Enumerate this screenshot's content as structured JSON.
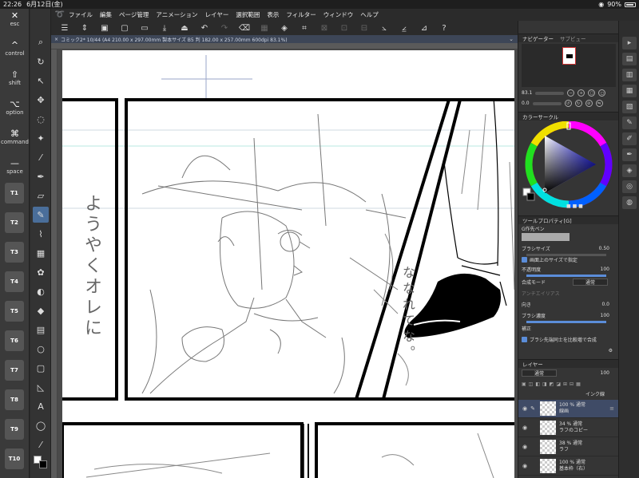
{
  "status": {
    "time": "22:26",
    "date": "6月12日(金)",
    "battery": "90%"
  },
  "modifiers": [
    {
      "glyph": "✕",
      "label": "esc"
    },
    {
      "glyph": "^",
      "label": "control"
    },
    {
      "glyph": "⇧",
      "label": "shift"
    },
    {
      "glyph": "⌥",
      "label": "option"
    },
    {
      "glyph": "⌘",
      "label": "command"
    },
    {
      "glyph": "—",
      "label": "space"
    }
  ],
  "tkeys": [
    "T1",
    "T2",
    "T3",
    "T4",
    "T5",
    "T6",
    "T7",
    "T8",
    "T9",
    "T10"
  ],
  "menu": [
    "ファイル",
    "編集",
    "ページ管理",
    "アニメーション",
    "レイヤー",
    "選択範囲",
    "表示",
    "フィルター",
    "ウィンドウ",
    "ヘルプ"
  ],
  "document": {
    "tab": "コミック2* 10/44 (A4 210.00 x 297.00mm 製本サイズ B5 判 182.00 x 257.00mm 600dpi 83.1%)"
  },
  "canvas": {
    "handwriting": "ようやくオレに",
    "handwriting2": "ななれてな。"
  },
  "navigator": {
    "title": "ナビゲーター",
    "tab2": "サブビュー",
    "zoom": "83.1",
    "rotation": "0.0"
  },
  "color": {
    "title": "カラーサークル"
  },
  "tool_property": {
    "title": "ツールプロパティ[G]",
    "tool": "G作先ペン",
    "brush_size_label": "ブラシサイズ",
    "brush_size": "0.50",
    "screen_size_label": "画面上のサイズで指定",
    "opacity_label": "不透明度",
    "opacity": "100",
    "blend_label": "合成モード",
    "blend": "通常",
    "antialias_label": "アンチエイリアス",
    "direction_label": "向き",
    "direction": "0.0",
    "density_label": "ブラシ濃度",
    "density": "100",
    "stabilize_label": "補正",
    "combine_label": "ブラシ先端同士を比較増で合成"
  },
  "layer_panel": {
    "title": "レイヤー",
    "blend": "通常",
    "opacity": "100",
    "folder_label": "インク線",
    "layers": [
      {
        "line1": "100 % 通常",
        "line2": "線画",
        "selected": true
      },
      {
        "line1": "34 % 通常",
        "line2": "ラフのコピー",
        "selected": false
      },
      {
        "line1": "38 % 通常",
        "line2": "ラフ",
        "selected": false
      },
      {
        "line1": "100 % 通常",
        "line2": "基本枠（右）",
        "selected": false
      }
    ]
  }
}
